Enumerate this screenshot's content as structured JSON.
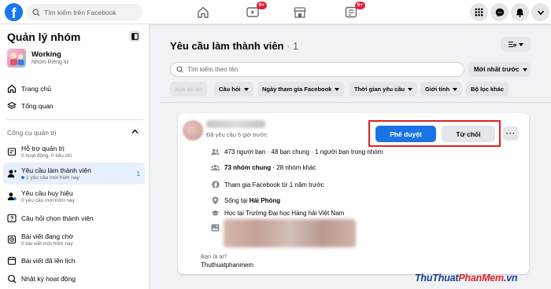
{
  "topbar": {
    "search_placeholder": "Tìm kiếm trên Facebook",
    "watch_badge": "9+",
    "groups_badge": "9+"
  },
  "sidebar": {
    "title": "Quản lý nhóm",
    "group_name": "Working",
    "group_privacy": "Nhóm Riêng tư",
    "home": "Trang chủ",
    "overview": "Tổng quan",
    "admin_tools_section": "Công cụ quản trị",
    "admin_assist": "Hỗ trợ quản trị",
    "admin_assist_sub": "0 hoạt động, 0 tiêu chí",
    "member_requests": "Yêu cầu làm thành viên",
    "member_requests_sub": "1 yêu cầu mới hôm nay",
    "member_requests_count": "1",
    "badge_requests": "Yêu cầu huy hiệu",
    "badge_requests_sub": "0 yêu cầu mới hôm nay",
    "membership_questions": "Câu hỏi chọn thành viên",
    "pending_posts": "Bài viết đang chờ",
    "pending_posts_sub": "0 bài viết mới hôm nay",
    "scheduled_posts": "Bài viết đã lên lịch",
    "activity_log": "Nhật ký hoạt động"
  },
  "main": {
    "title": "Yêu cầu làm thành viên",
    "title_count": " · 1",
    "search_placeholder": "Tìm kiếm theo tên",
    "sort_label": "Mới nhất trước",
    "filters": {
      "clear": "Xóa bộ lọc",
      "questions": "Câu hỏi",
      "join_date": "Ngày tham gia Facebook",
      "request_time": "Thời gian yêu cầu",
      "gender": "Giới tính",
      "more": "Bộ lọc khác"
    }
  },
  "request": {
    "time": "Đã yêu cầu 6 giờ trước",
    "approve": "Phê duyệt",
    "decline": "Từ chối",
    "more": "···",
    "friends": "473 người bạn · 48 bạn chung · 1 người bạn trong nhóm",
    "groups_bold": "73 nhóm chung",
    "groups_rest": " · 28 nhóm khác",
    "joined": "Tham gia Facebook từ 1 năm trước",
    "lives_prefix": "Sống tại ",
    "lives_city": "Hải Phòng",
    "studied": "Học tại Trường Đại học Hàng hải Việt Nam",
    "question": "Bạn là ai?",
    "answer": "Thuthuatphanmem"
  },
  "watermark": {
    "part1": "ThuThuat",
    "part2": "PhanMem",
    "part3": ".vn"
  },
  "colors": {
    "brand_blue": "#1877f2",
    "badge_red": "#e41e3f",
    "highlight_red": "#e02020"
  }
}
